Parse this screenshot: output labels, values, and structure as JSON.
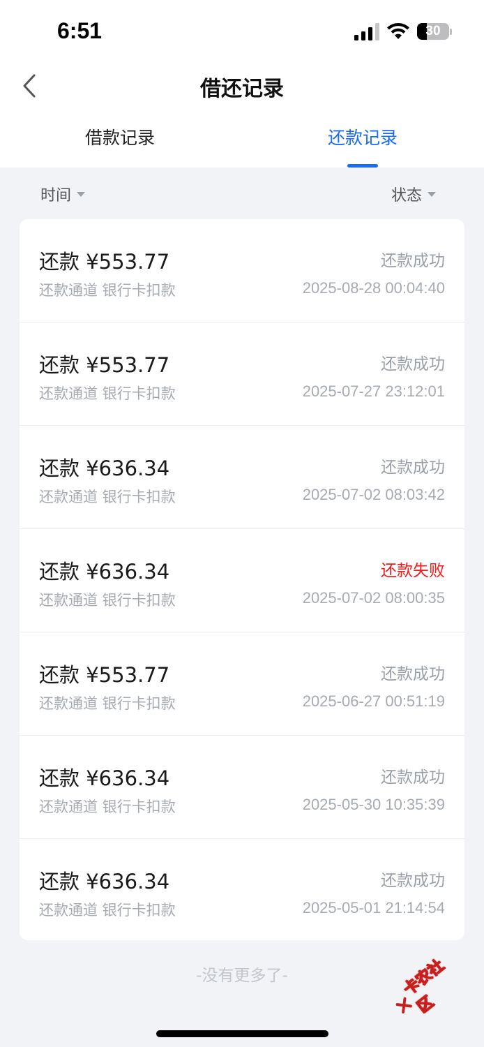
{
  "status_bar": {
    "time": "6:51",
    "battery_level": "30",
    "battery_fraction": 0.3
  },
  "nav": {
    "title": "借还记录",
    "back_icon": "chevron-left-icon"
  },
  "tabs": [
    {
      "label": "借款记录",
      "active": false
    },
    {
      "label": "还款记录",
      "active": true
    }
  ],
  "filters": {
    "time_label": "时间",
    "status_label": "状态"
  },
  "records": [
    {
      "amount": "还款 ¥553.77",
      "status": "还款成功",
      "status_type": "success",
      "channel": "还款通道 银行卡扣款",
      "time": "2025-08-28 00:04:40"
    },
    {
      "amount": "还款 ¥553.77",
      "status": "还款成功",
      "status_type": "success",
      "channel": "还款通道 银行卡扣款",
      "time": "2025-07-27 23:12:01"
    },
    {
      "amount": "还款 ¥636.34",
      "status": "还款成功",
      "status_type": "success",
      "channel": "还款通道 银行卡扣款",
      "time": "2025-07-02 08:03:42"
    },
    {
      "amount": "还款 ¥636.34",
      "status": "还款失败",
      "status_type": "fail",
      "channel": "还款通道 银行卡扣款",
      "time": "2025-07-02 08:00:35"
    },
    {
      "amount": "还款 ¥553.77",
      "status": "还款成功",
      "status_type": "success",
      "channel": "还款通道 银行卡扣款",
      "time": "2025-06-27 00:51:19"
    },
    {
      "amount": "还款 ¥636.34",
      "status": "还款成功",
      "status_type": "success",
      "channel": "还款通道 银行卡扣款",
      "time": "2025-05-30 10:35:39"
    },
    {
      "amount": "还款 ¥636.34",
      "status": "还款成功",
      "status_type": "success",
      "channel": "还款通道 银行卡扣款",
      "time": "2025-05-01 21:14:54"
    }
  ],
  "footer": {
    "no_more": "-没有更多了-"
  },
  "watermark": {
    "text": "卡农社区"
  },
  "colors": {
    "accent": "#1b6cf2",
    "fail": "#f21b1b",
    "muted": "#9aa0a8",
    "background": "#f2f3f6"
  }
}
